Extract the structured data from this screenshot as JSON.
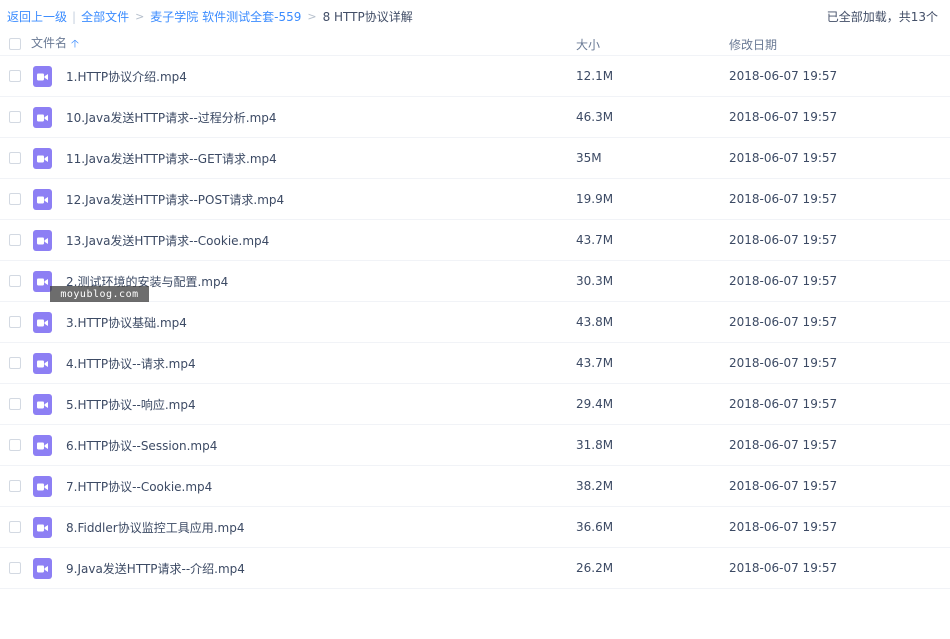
{
  "breadcrumb": {
    "back": "返回上一级",
    "all_files": "全部文件",
    "folder": "麦子学院 软件测试全套-559",
    "current": "8 HTTP协议详解"
  },
  "status": "已全部加载，共13个",
  "columns": {
    "name": "文件名",
    "size": "大小",
    "date": "修改日期"
  },
  "icons": {
    "sort": "sort-up-arrow-icon",
    "file": "video-file-icon"
  },
  "colors": {
    "accent": "#3b8cff",
    "video_icon": "#8d7ff4"
  },
  "watermark": "moyublog.com",
  "files": [
    {
      "name": "1.HTTP协议介绍.mp4",
      "size": "12.1M",
      "date": "2018-06-07 19:57"
    },
    {
      "name": "10.Java发送HTTP请求--过程分析.mp4",
      "size": "46.3M",
      "date": "2018-06-07 19:57"
    },
    {
      "name": "11.Java发送HTTP请求--GET请求.mp4",
      "size": "35M",
      "date": "2018-06-07 19:57"
    },
    {
      "name": "12.Java发送HTTP请求--POST请求.mp4",
      "size": "19.9M",
      "date": "2018-06-07 19:57"
    },
    {
      "name": "13.Java发送HTTP请求--Cookie.mp4",
      "size": "43.7M",
      "date": "2018-06-07 19:57"
    },
    {
      "name": "2.测试环境的安装与配置.mp4",
      "size": "30.3M",
      "date": "2018-06-07 19:57"
    },
    {
      "name": "3.HTTP协议基础.mp4",
      "size": "43.8M",
      "date": "2018-06-07 19:57"
    },
    {
      "name": "4.HTTP协议--请求.mp4",
      "size": "43.7M",
      "date": "2018-06-07 19:57"
    },
    {
      "name": "5.HTTP协议--响应.mp4",
      "size": "29.4M",
      "date": "2018-06-07 19:57"
    },
    {
      "name": "6.HTTP协议--Session.mp4",
      "size": "31.8M",
      "date": "2018-06-07 19:57"
    },
    {
      "name": "7.HTTP协议--Cookie.mp4",
      "size": "38.2M",
      "date": "2018-06-07 19:57"
    },
    {
      "name": "8.Fiddler协议监控工具应用.mp4",
      "size": "36.6M",
      "date": "2018-06-07 19:57"
    },
    {
      "name": "9.Java发送HTTP请求--介绍.mp4",
      "size": "26.2M",
      "date": "2018-06-07 19:57"
    }
  ]
}
